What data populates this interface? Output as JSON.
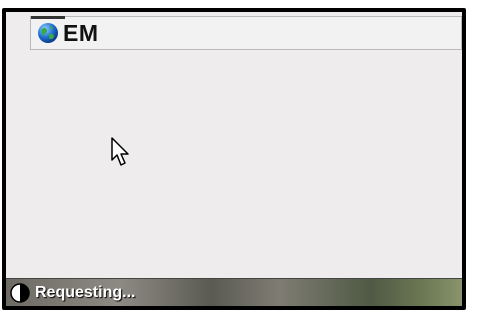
{
  "address_bar": {
    "value": "EM",
    "icon": "globe-icon"
  },
  "content": {
    "cursor_icon": "mouse-pointer-icon"
  },
  "status_bar": {
    "icon": "loading-half-circle-icon",
    "text": "Requesting..."
  }
}
